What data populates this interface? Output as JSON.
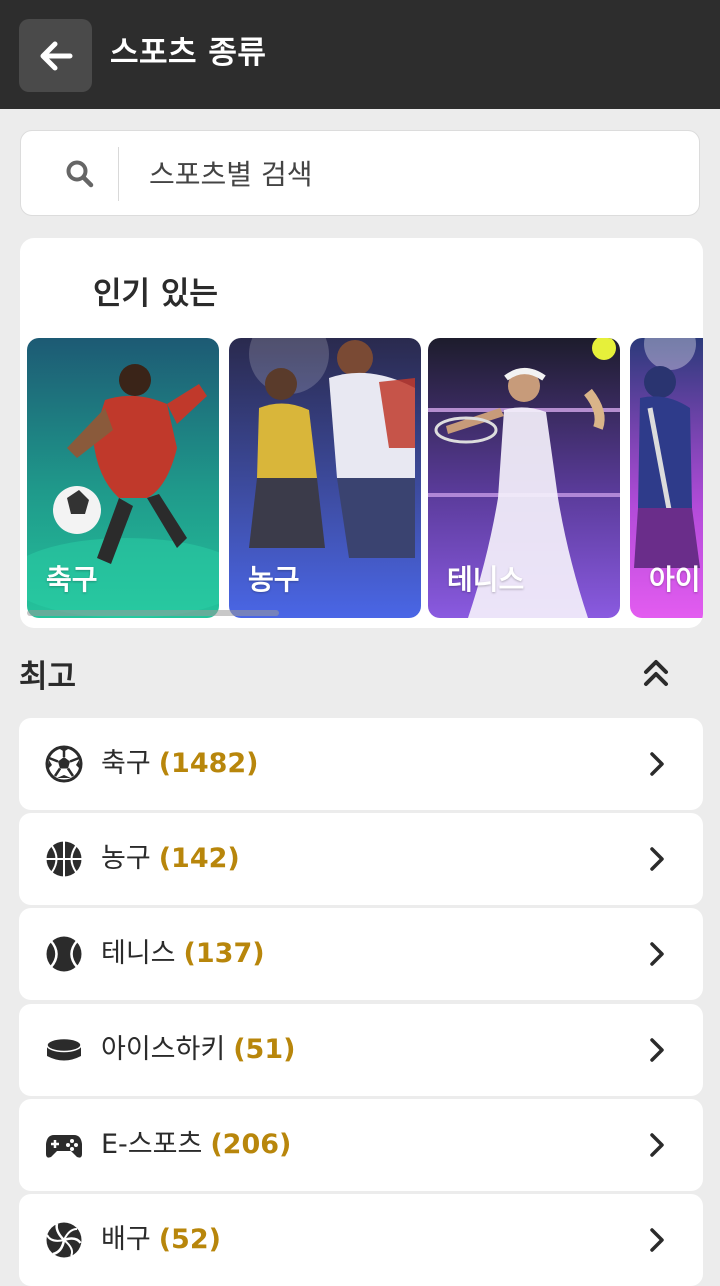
{
  "header": {
    "title": "스포츠 종류",
    "back_icon": "arrow-left-icon"
  },
  "search": {
    "placeholder": "스포츠별 검색",
    "value": "",
    "icon": "search-icon"
  },
  "popular": {
    "title": "인기 있는",
    "cards": [
      {
        "label": "축구"
      },
      {
        "label": "농구"
      },
      {
        "label": "테니스"
      },
      {
        "label": "아이"
      }
    ]
  },
  "top": {
    "title": "최고",
    "collapse_icon": "double-chevron-up-icon",
    "items": [
      {
        "name": "축구",
        "count": "(1482)",
        "icon": "soccer-ball-icon"
      },
      {
        "name": "농구",
        "count": "(142)",
        "icon": "basketball-icon"
      },
      {
        "name": "테니스",
        "count": "(137)",
        "icon": "tennis-ball-icon"
      },
      {
        "name": "아이스하키",
        "count": "(51)",
        "icon": "hockey-puck-icon"
      },
      {
        "name": "E-스포츠",
        "count": "(206)",
        "icon": "gamepad-icon"
      },
      {
        "name": "배구",
        "count": "(52)",
        "icon": "volleyball-icon"
      }
    ]
  },
  "colors": {
    "header_bg": "#2d2d2d",
    "count_accent": "#b8860b",
    "page_bg": "#ececec"
  }
}
